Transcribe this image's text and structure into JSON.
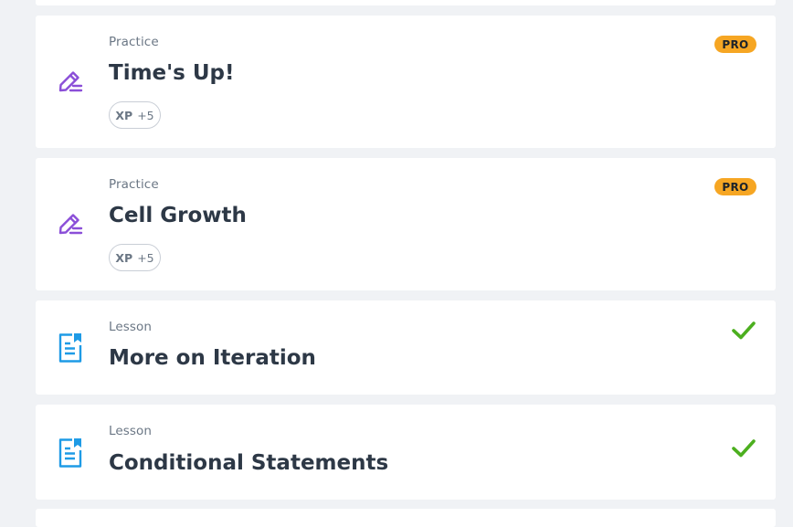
{
  "items": [
    {
      "kind": "Practice",
      "title": "Time's Up!",
      "xp_label": "XP",
      "xp_value": "+5",
      "badge": "PRO"
    },
    {
      "kind": "Practice",
      "title": "Cell Growth",
      "xp_label": "XP",
      "xp_value": "+5",
      "badge": "PRO"
    },
    {
      "kind": "Lesson",
      "title": "More on Iteration",
      "status": "completed"
    },
    {
      "kind": "Lesson",
      "title": "Conditional Statements",
      "status": "completed"
    }
  ],
  "colors": {
    "practice_icon": "#8b4fd8",
    "lesson_icon": "#1e9be6",
    "pro_badge": "#f6a623",
    "check": "#4caf1f",
    "page_bg": "#f0f2f5"
  },
  "icons": {
    "practice": "pencil-icon",
    "lesson": "lesson-document-icon",
    "completed": "checkmark-icon"
  }
}
